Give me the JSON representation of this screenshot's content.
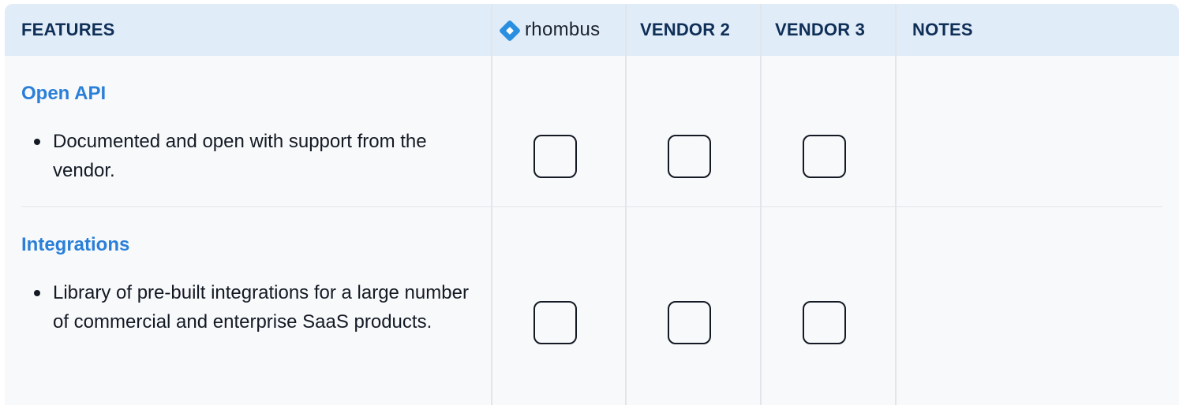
{
  "header": {
    "features": "FEATURES",
    "vendor1_name": "rhombus",
    "vendor2": "VENDOR 2",
    "vendor3": "VENDOR 3",
    "notes": "NOTES"
  },
  "rows": [
    {
      "title": "Open API",
      "bullet": "Documented and open with support from the vendor.",
      "checked": [
        false,
        false,
        false
      ]
    },
    {
      "title": "Integrations",
      "bullet": "Library of pre-built integrations for a large number of commercial and enterprise SaaS products.",
      "checked": [
        false,
        false,
        false
      ]
    }
  ],
  "colors": {
    "header_bg": "#e1ecf9",
    "header_text": "#0f2f57",
    "feature_title": "#2a7fd8",
    "brand": "#2a8fe0",
    "body_bg": "#f8f9fb"
  },
  "icons": {
    "logo": "rhombus-diamond-icon",
    "bullet": "bullet-dot-icon"
  }
}
